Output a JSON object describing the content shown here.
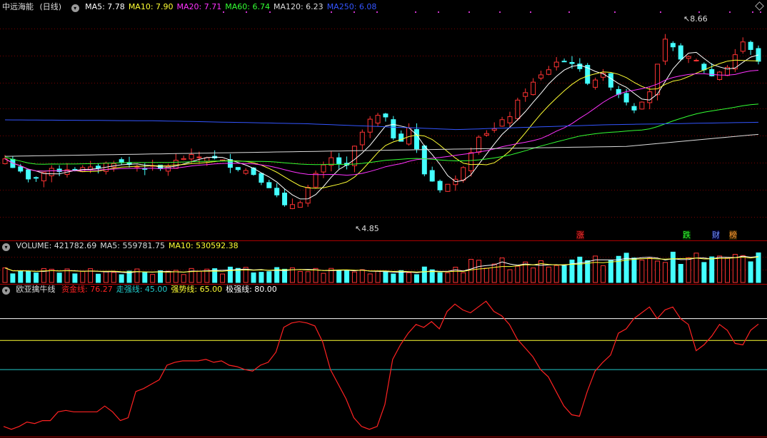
{
  "stock": {
    "name": "中远海能",
    "period": "(日线)"
  },
  "price_header": {
    "ma": [
      {
        "label": "MA5: 7.78",
        "color": "#ffffff"
      },
      {
        "label": "MA10: 7.90",
        "color": "#ffff33"
      },
      {
        "label": "MA20: 7.71",
        "color": "#ff33ff"
      },
      {
        "label": "MA60: 6.74",
        "color": "#33ff33"
      },
      {
        "label": "MA120: 6.23",
        "color": "#dddddd"
      },
      {
        "label": "MA250: 6.08",
        "color": "#3355ff"
      }
    ]
  },
  "volume_header": {
    "items": [
      {
        "label": "VOLUME: 421782.69",
        "color": "#dddddd"
      },
      {
        "label": "MA5: 559781.75",
        "color": "#dddddd"
      },
      {
        "label": "MA10: 530592.38",
        "color": "#ffff33"
      }
    ]
  },
  "indicator_header": {
    "name": "欧亚擒牛线",
    "items": [
      {
        "label": "资金线: 76.27",
        "color": "#ff2222"
      },
      {
        "label": "走强线: 45.00",
        "color": "#22cccc"
      },
      {
        "label": "强势线: 65.00",
        "color": "#ffff33"
      },
      {
        "label": "极强线: 80.00",
        "color": "#ffffff"
      }
    ]
  },
  "annotations": {
    "high": "8.66",
    "low": "4.85"
  },
  "signals": [
    {
      "text": "涨",
      "color": "#ff3333",
      "bg": "#3a0000"
    },
    {
      "text": "跌",
      "color": "#33ff33",
      "bg": "#002a00"
    },
    {
      "text": "财",
      "color": "#7799ff",
      "bg": "#000033"
    },
    {
      "text": "榜",
      "color": "#ff9933",
      "bg": "#332000"
    }
  ],
  "colors": {
    "up": "#ff3333",
    "down": "#44ffff",
    "grid": "#7a0000",
    "frame": "#aa0000",
    "ma5": "#ffffff",
    "ma10": "#ffff33",
    "ma20": "#ff33ff",
    "ma60": "#33ff33",
    "ma120": "#dddddd",
    "ma250": "#3355ff",
    "fund_line": "#ff2222",
    "weak_level": "#22cccc",
    "strong_level": "#ffff33",
    "extreme_level": "#ffffff"
  },
  "chart_data": [
    {
      "type": "candlestick",
      "title": "中远海能 (日线)",
      "ylim": [
        4.5,
        8.9
      ],
      "annotations": [
        {
          "label": "8.66",
          "value": 8.66,
          "kind": "high"
        },
        {
          "label": "4.85",
          "value": 4.85,
          "kind": "low"
        }
      ],
      "moving_averages": [
        {
          "name": "MA5",
          "last": 7.78
        },
        {
          "name": "MA10",
          "last": 7.9
        },
        {
          "name": "MA20",
          "last": 7.71
        },
        {
          "name": "MA60",
          "last": 6.74
        },
        {
          "name": "MA120",
          "last": 6.23
        },
        {
          "name": "MA250",
          "last": 6.08
        }
      ],
      "ma250_values": [
        6.7,
        6.68,
        6.62,
        6.5,
        6.6,
        6.65
      ]
    },
    {
      "type": "bar",
      "title": "VOLUME",
      "last": 421782.69,
      "ma5": 559781.75,
      "ma10": 530592.38
    },
    {
      "type": "line",
      "title": "欧亚擒牛线",
      "series": [
        {
          "name": "资金线",
          "last": 76.27,
          "values": [
            6,
            4,
            6,
            9,
            8,
            10,
            10,
            16,
            17,
            16,
            16,
            16,
            16,
            20,
            16,
            10,
            12,
            30,
            32,
            35,
            38,
            48,
            50,
            51,
            51,
            51,
            52,
            50,
            51,
            48,
            47,
            45,
            44,
            48,
            50,
            57,
            74,
            77,
            78,
            77,
            75,
            64,
            45,
            35,
            25,
            12,
            6,
            4,
            6,
            21,
            52,
            62,
            70,
            76,
            74,
            78,
            73,
            85,
            90,
            86,
            84,
            88,
            92,
            85,
            82,
            76,
            66,
            60,
            54,
            45,
            40,
            30,
            20,
            14,
            13,
            30,
            44,
            50,
            55,
            70,
            73,
            80,
            84,
            88,
            80,
            86,
            88,
            80,
            76,
            58,
            62,
            68,
            76,
            72,
            63,
            62,
            72,
            76.27
          ]
        }
      ],
      "levels": [
        {
          "name": "走强线",
          "value": 45
        },
        {
          "name": "强势线",
          "value": 65
        },
        {
          "name": "极强线",
          "value": 80
        }
      ],
      "ylim": [
        0,
        96
      ]
    }
  ]
}
